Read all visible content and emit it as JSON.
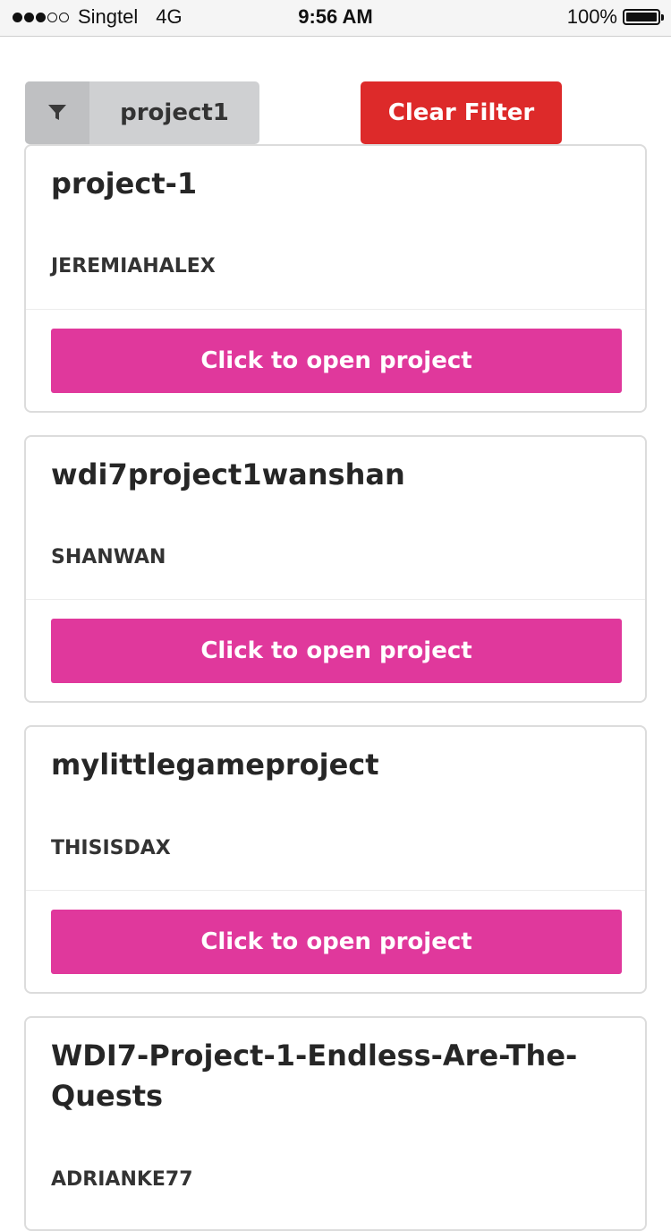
{
  "status_bar": {
    "carrier": "Singtel",
    "network": "4G",
    "time": "9:56 AM",
    "battery": "100%",
    "battery_level": 1.0,
    "signal_bars_filled": 3,
    "signal_bars_total": 5
  },
  "filter": {
    "label": "project1",
    "icon": "filter-icon",
    "clear_label": "Clear Filter"
  },
  "colors": {
    "accent": "#e0389c",
    "danger": "#dd2a2a",
    "chip": "#cfd0d2"
  },
  "projects": [
    {
      "title": "project-1",
      "author": "JEREMIAHALEX",
      "button": "Click to open project"
    },
    {
      "title": "wdi7project1wanshan",
      "author": "SHANWAN",
      "button": "Click to open project"
    },
    {
      "title": "mylittlegameproject",
      "author": "THISISDAX",
      "button": "Click to open project"
    },
    {
      "title": "WDI7-Project-1-Endless-Are-The-Quests",
      "author": "ADRIANKE77"
    }
  ]
}
